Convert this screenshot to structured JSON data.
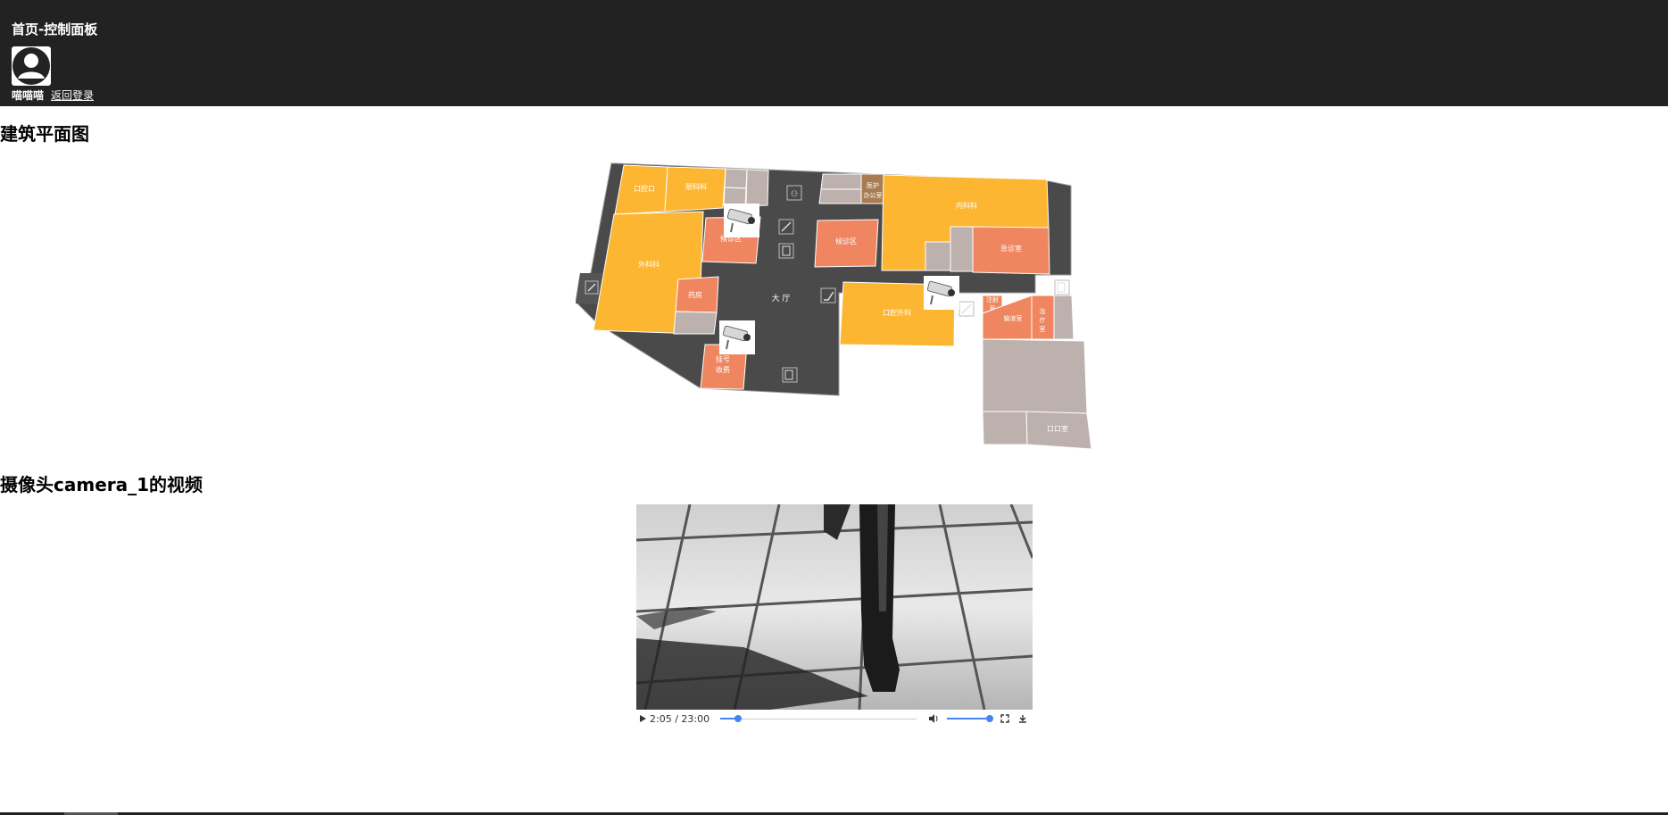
{
  "header": {
    "title": "首页-控制面板",
    "username": "喵喵喵",
    "logout_link": "返回登录"
  },
  "floorplan": {
    "heading": "建筑平面图",
    "rooms": {
      "r1": "口腔口",
      "r2": "眼科科",
      "r3": "外科科",
      "r4": "候诊区",
      "r5": "候诊区",
      "r6": "药房",
      "r7": "挂号收费",
      "r8": "大 厅",
      "r9": "医护办公室",
      "r10": "内科科",
      "r11": "急诊室",
      "r12": "口腔外科",
      "r13": "注射室",
      "r14": "输液室",
      "r15": "治疗室",
      "r16": "口口室"
    },
    "colors": {
      "corridor": "#4a4a4a",
      "yellow": "#fcb632",
      "orange": "#ef8660",
      "gray": "#bdb1ad",
      "brown": "#a97c50"
    },
    "cameras": [
      "camera-icon",
      "camera-icon",
      "camera-icon"
    ]
  },
  "video": {
    "heading": "摄像头camera_1的视频",
    "time_current": "2:05",
    "time_total": "23:00",
    "progress": 0.09,
    "volume": 1.0,
    "icons": [
      "play-icon",
      "volume-icon",
      "fullscreen-icon",
      "download-icon"
    ]
  }
}
